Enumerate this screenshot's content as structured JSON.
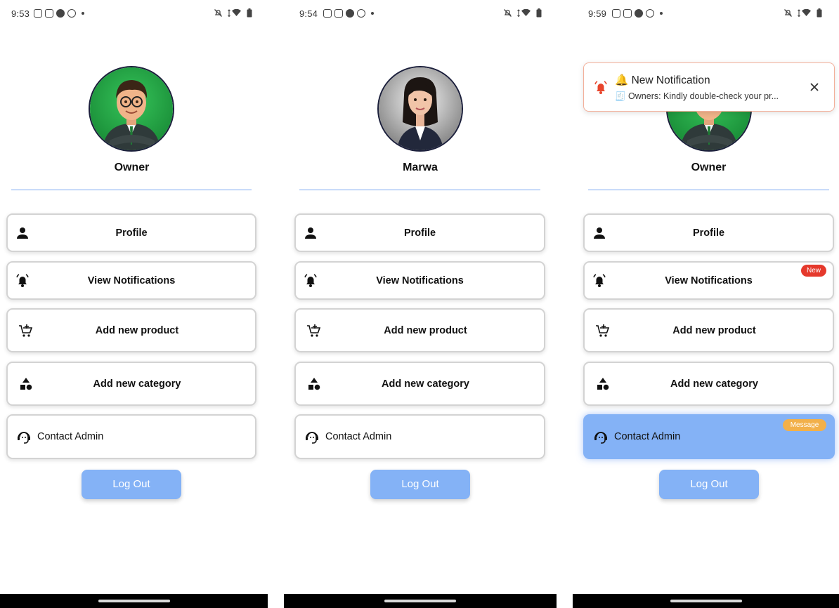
{
  "screens": [
    {
      "status_time": "9:53",
      "user_name": "Owner",
      "menu": {
        "profile": "Profile",
        "notifications": "View Notifications",
        "add_product": "Add new product",
        "add_category": "Add new category",
        "contact_admin": "Contact Admin"
      },
      "logout": "Log Out"
    },
    {
      "status_time": "9:54",
      "user_name": "Marwa",
      "menu": {
        "profile": "Profile",
        "notifications": "View Notifications",
        "add_product": "Add new product",
        "add_category": "Add new category",
        "contact_admin": "Contact Admin"
      },
      "logout": "Log Out"
    },
    {
      "status_time": "9:59",
      "user_name": "Owner",
      "menu": {
        "profile": "Profile",
        "notifications": "View Notifications",
        "notifications_badge": "New",
        "add_product": "Add new product",
        "add_category": "Add new category",
        "contact_admin": "Contact Admin",
        "contact_badge": "Message"
      },
      "logout": "Log Out",
      "toast": {
        "title": "🔔 New Notification",
        "body": "🧾 Owners: Kindly double-check your pr..."
      }
    }
  ],
  "colors": {
    "accent": "#84b2f6",
    "divider": "#7aa6f2",
    "badge_new": "#e5392c",
    "badge_message": "#f2b04a",
    "toast_border": "#f3b09b",
    "bell_alert": "#e8452c"
  },
  "icons": {
    "profile": "person-icon",
    "notifications": "bell-ring-icon",
    "add_product": "cart-plus-icon",
    "add_category": "shapes-icon",
    "contact_admin": "support-agent-icon",
    "toast_close": "close-icon"
  }
}
